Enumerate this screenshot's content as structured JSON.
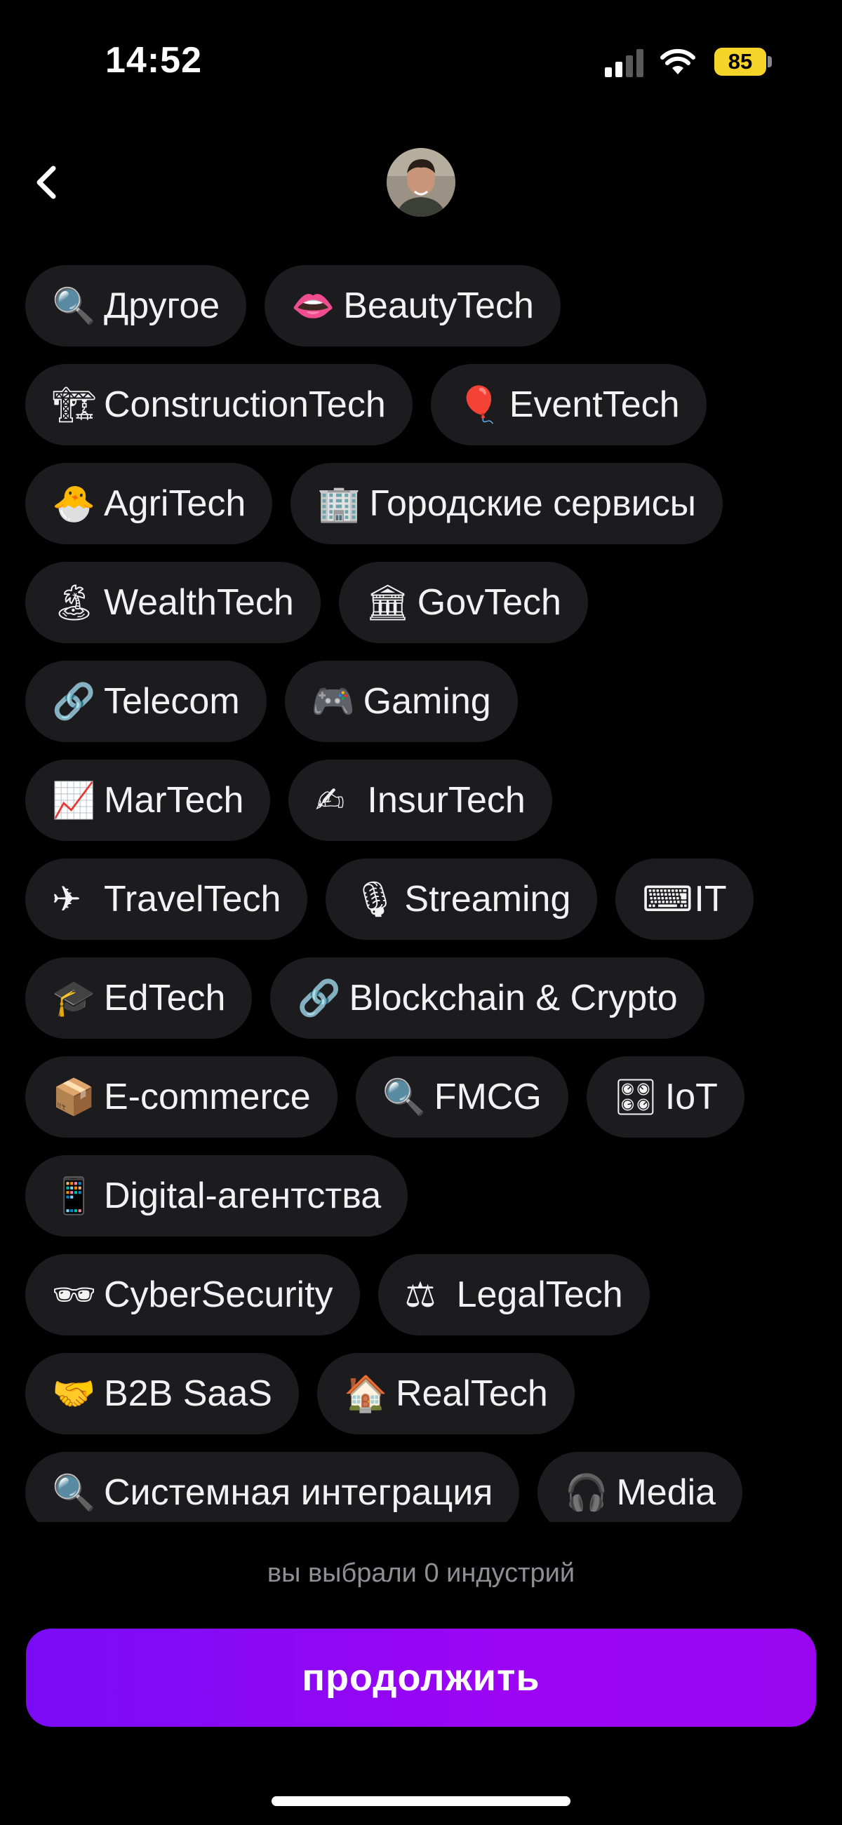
{
  "status_bar": {
    "time": "14:52",
    "battery": "85",
    "icons": [
      "signal-icon",
      "wifi-icon",
      "battery-icon"
    ]
  },
  "header": {
    "back_icon": "chevron-left-icon",
    "avatar": "avatar"
  },
  "industries": [
    {
      "emoji": "🔍",
      "label": "Другое"
    },
    {
      "emoji": "👄",
      "label": "BeautyTech"
    },
    {
      "emoji": "🏗",
      "label": "ConstructionTech"
    },
    {
      "emoji": "🎈",
      "label": "EventTech"
    },
    {
      "emoji": "🐣",
      "label": "AgriTech"
    },
    {
      "emoji": "🏢",
      "label": "Городские сервисы"
    },
    {
      "emoji": "🏝",
      "label": "WealthTech"
    },
    {
      "emoji": "🏛",
      "label": "GovTech"
    },
    {
      "emoji": "🔗",
      "label": "Telecom"
    },
    {
      "emoji": "🎮",
      "label": "Gaming"
    },
    {
      "emoji": "📈",
      "label": "MarTech"
    },
    {
      "emoji": "✍",
      "label": "InsurTech"
    },
    {
      "emoji": "✈",
      "label": "TravelTech"
    },
    {
      "emoji": "🎙",
      "label": "Streaming"
    },
    {
      "emoji": "⌨",
      "label": "IT"
    },
    {
      "emoji": "🎓",
      "label": "EdTech"
    },
    {
      "emoji": "🔗",
      "label": "Blockchain & Crypto"
    },
    {
      "emoji": "📦",
      "label": "E-commerce"
    },
    {
      "emoji": "🔍",
      "label": "FMCG"
    },
    {
      "emoji": "🎛",
      "label": "IoT"
    },
    {
      "emoji": "📱",
      "label": "Digital-агентства"
    },
    {
      "emoji": "🕶",
      "label": "CyberSecurity"
    },
    {
      "emoji": "⚖",
      "label": "LegalTech"
    },
    {
      "emoji": "🤝",
      "label": "B2B SaaS"
    },
    {
      "emoji": "🏠",
      "label": "RealTech"
    },
    {
      "emoji": "🔍",
      "label": "Системная интеграция"
    },
    {
      "emoji": "🎧",
      "label": "Media"
    }
  ],
  "footer": {
    "selected_text": "вы выбрали 0 индустрий",
    "continue_label": "продолжить"
  }
}
